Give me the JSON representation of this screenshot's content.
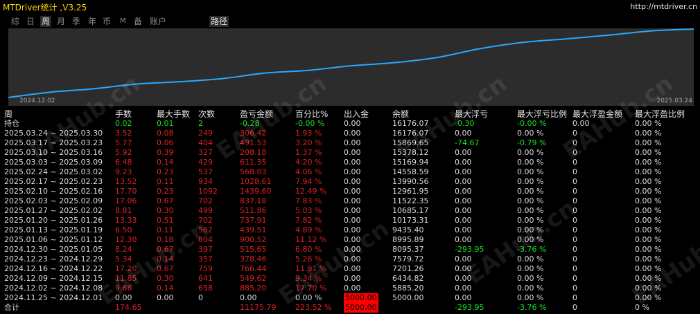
{
  "app": {
    "title": "MTDriver统计 ,V3.25",
    "url": "http://mtdriver.cn"
  },
  "tabs": [
    {
      "label": "综",
      "active": false
    },
    {
      "label": "日",
      "active": false
    },
    {
      "label": "周",
      "active": true
    },
    {
      "label": "月",
      "active": false
    },
    {
      "label": "季",
      "active": false
    },
    {
      "label": "年",
      "active": false
    },
    {
      "label": "币",
      "active": false
    },
    {
      "label": "M",
      "active": false
    },
    {
      "label": "备",
      "active": false
    },
    {
      "label": "账户",
      "active": false
    },
    {
      "label": "路径",
      "active": true
    }
  ],
  "colors": {
    "chart_bg": "#2c2c2c",
    "line": "#29a8ff",
    "red": "#e02020",
    "green": "#15e51e",
    "white": "#dcdcdc"
  },
  "chart_data": {
    "type": "line",
    "x_start_label": "2024.12.02",
    "x_end_label": "2025.03.24",
    "x": [
      "2024.12.02",
      "2024.12.09",
      "2024.12.16",
      "2024.12.23",
      "2024.12.30",
      "2025.01.06",
      "2025.01.13",
      "2025.01.20",
      "2025.01.27",
      "2025.02.03",
      "2025.02.10",
      "2025.02.17",
      "2025.02.24",
      "2025.03.03",
      "2025.03.10",
      "2025.03.17",
      "2025.03.24"
    ],
    "values": [
      5000.0,
      5885.2,
      6434.82,
      7201.26,
      7579.72,
      8095.37,
      8995.89,
      9435.4,
      10173.31,
      10685.17,
      11522.35,
      12961.95,
      13990.56,
      14558.59,
      15169.94,
      15869.65,
      16176.07
    ],
    "grid": false
  },
  "table": {
    "headers": [
      "周",
      "手数",
      "最大手数",
      "次数",
      "盈亏金额",
      "百分比%",
      "出入金",
      "余额",
      "最大浮亏",
      "最大浮亏比例",
      "最大浮盈金额",
      "最大浮盈比例"
    ],
    "holding": {
      "cells": [
        "持仓",
        "0.02",
        "0.01",
        "2",
        "-0.28",
        "-0.00 %",
        "0.00",
        "16176.07",
        "-0.30",
        "-0.00 %",
        "0.00",
        "0.00 %"
      ],
      "colors": [
        "w",
        "g",
        "g",
        "g",
        "g",
        "g",
        "w",
        "w",
        "g",
        "g",
        "w",
        "w"
      ]
    },
    "rows": [
      {
        "cells": [
          "2025.03.24 ~ 2025.03.30",
          "3.52",
          "0.08",
          "249",
          "306.42",
          "1.93 %",
          "0.00",
          "16176.07",
          "0.00",
          "0.00 %",
          "0",
          "0.00 %"
        ],
        "colors": [
          "w",
          "r",
          "r",
          "r",
          "r",
          "r",
          "w",
          "w",
          "w",
          "w",
          "w",
          "w"
        ]
      },
      {
        "cells": [
          "2025.03.17 ~ 2025.03.23",
          "5.77",
          "0.06",
          "404",
          "491.53",
          "3.20 %",
          "0.00",
          "15869.65",
          "-74.67",
          "-0.79 %",
          "0",
          "0.00 %"
        ],
        "colors": [
          "w",
          "r",
          "r",
          "r",
          "r",
          "r",
          "w",
          "w",
          "g",
          "g",
          "w",
          "w"
        ]
      },
      {
        "cells": [
          "2025.03.10 ~ 2025.03.16",
          "5.92",
          "0.39",
          "327",
          "208.18",
          "1.37 %",
          "0.00",
          "15378.12",
          "0.00",
          "0.00 %",
          "0",
          "0.00 %"
        ],
        "colors": [
          "w",
          "r",
          "r",
          "r",
          "r",
          "r",
          "w",
          "w",
          "w",
          "w",
          "w",
          "w"
        ]
      },
      {
        "cells": [
          "2025.03.03 ~ 2025.03.09",
          "6.48",
          "0.14",
          "429",
          "611.35",
          "4.20 %",
          "0.00",
          "15169.94",
          "0.00",
          "0.00 %",
          "0",
          "0.00 %"
        ],
        "colors": [
          "w",
          "r",
          "r",
          "r",
          "r",
          "r",
          "w",
          "w",
          "w",
          "w",
          "w",
          "w"
        ]
      },
      {
        "cells": [
          "2025.02.24 ~ 2025.03.02",
          "9.23",
          "0.23",
          "537",
          "568.03",
          "4.06 %",
          "0.00",
          "14558.59",
          "0.00",
          "0.00 %",
          "0",
          "0.00 %"
        ],
        "colors": [
          "w",
          "r",
          "r",
          "r",
          "r",
          "r",
          "w",
          "w",
          "w",
          "w",
          "w",
          "w"
        ]
      },
      {
        "cells": [
          "2025.02.17 ~ 2025.02.23",
          "13.52",
          "0.11",
          "934",
          "1028.61",
          "7.94 %",
          "0.00",
          "13990.56",
          "0.00",
          "0.00 %",
          "0",
          "0.00 %"
        ],
        "colors": [
          "w",
          "r",
          "r",
          "r",
          "r",
          "r",
          "w",
          "w",
          "w",
          "w",
          "w",
          "w"
        ]
      },
      {
        "cells": [
          "2025.02.10 ~ 2025.02.16",
          "17.70",
          "0.23",
          "1092",
          "1439.60",
          "12.49 %",
          "0.00",
          "12961.95",
          "0.00",
          "0.00 %",
          "0",
          "0.00 %"
        ],
        "colors": [
          "w",
          "r",
          "r",
          "r",
          "r",
          "r",
          "w",
          "w",
          "w",
          "w",
          "w",
          "w"
        ]
      },
      {
        "cells": [
          "2025.02.03 ~ 2025.02.09",
          "17.06",
          "0.67",
          "702",
          "837.18",
          "7.83 %",
          "0.00",
          "11522.35",
          "0.00",
          "0.00 %",
          "0",
          "0.00 %"
        ],
        "colors": [
          "w",
          "r",
          "r",
          "r",
          "r",
          "r",
          "w",
          "w",
          "w",
          "w",
          "w",
          "w"
        ]
      },
      {
        "cells": [
          "2025.01.27 ~ 2025.02.02",
          "8.81",
          "0.30",
          "499",
          "511.86",
          "5.03 %",
          "0.00",
          "10685.17",
          "0.00",
          "0.00 %",
          "0",
          "0.00 %"
        ],
        "colors": [
          "w",
          "r",
          "r",
          "r",
          "r",
          "r",
          "w",
          "w",
          "w",
          "w",
          "w",
          "w"
        ]
      },
      {
        "cells": [
          "2025.01.20 ~ 2025.01.26",
          "13.33",
          "0.51",
          "702",
          "737.91",
          "7.82 %",
          "0.00",
          "10173.31",
          "0.00",
          "0.00 %",
          "0",
          "0.00 %"
        ],
        "colors": [
          "w",
          "r",
          "r",
          "r",
          "r",
          "r",
          "w",
          "w",
          "w",
          "w",
          "w",
          "w"
        ]
      },
      {
        "cells": [
          "2025.01.13 ~ 2025.01.19",
          "6.50",
          "0.11",
          "562",
          "439.51",
          "4.89 %",
          "0.00",
          "9435.40",
          "0.00",
          "0.00 %",
          "0",
          "0.00 %"
        ],
        "colors": [
          "w",
          "r",
          "r",
          "r",
          "r",
          "r",
          "w",
          "w",
          "w",
          "w",
          "w",
          "w"
        ]
      },
      {
        "cells": [
          "2025.01.06 ~ 2025.01.12",
          "12.30",
          "0.18",
          "804",
          "900.52",
          "11.12 %",
          "0.00",
          "8995.89",
          "0.00",
          "0.00 %",
          "0",
          "0.00 %"
        ],
        "colors": [
          "w",
          "r",
          "r",
          "r",
          "r",
          "r",
          "w",
          "w",
          "w",
          "w",
          "w",
          "w"
        ]
      },
      {
        "cells": [
          "2024.12.30 ~ 2025.01.05",
          "8.24",
          "0.67",
          "397",
          "515.65",
          "6.80 %",
          "0.00",
          "8095.37",
          "-293.95",
          "-3.76 %",
          "0",
          "0.00 %"
        ],
        "colors": [
          "w",
          "r",
          "r",
          "r",
          "r",
          "r",
          "w",
          "w",
          "g",
          "g",
          "w",
          "w"
        ]
      },
      {
        "cells": [
          "2024.12.23 ~ 2024.12.29",
          "5.34",
          "0.14",
          "357",
          "378.46",
          "5.26 %",
          "0.00",
          "7579.72",
          "0.00",
          "0.00 %",
          "0",
          "0.00 %"
        ],
        "colors": [
          "w",
          "r",
          "r",
          "r",
          "r",
          "r",
          "w",
          "w",
          "w",
          "w",
          "w",
          "w"
        ]
      },
      {
        "cells": [
          "2024.12.16 ~ 2024.12.22",
          "17.20",
          "0.67",
          "759",
          "766.44",
          "11.91 %",
          "0.00",
          "7201.26",
          "0.00",
          "0.00 %",
          "0",
          "0.00 %"
        ],
        "colors": [
          "w",
          "r",
          "r",
          "r",
          "r",
          "r",
          "w",
          "w",
          "w",
          "w",
          "w",
          "w"
        ]
      },
      {
        "cells": [
          "2024.12.09 ~ 2024.12.15",
          "11.85",
          "0.30",
          "641",
          "549.62",
          "9.34 %",
          "0.00",
          "6434.82",
          "0.00",
          "0.00 %",
          "0",
          "0.00 %"
        ],
        "colors": [
          "w",
          "r",
          "r",
          "r",
          "r",
          "r",
          "w",
          "w",
          "w",
          "w",
          "w",
          "w"
        ]
      },
      {
        "cells": [
          "2024.12.02 ~ 2024.12.08",
          "9.86",
          "0.14",
          "658",
          "885.20",
          "17.70 %",
          "0.00",
          "5885.20",
          "0.00",
          "0.00 %",
          "0",
          "0.00 %"
        ],
        "colors": [
          "w",
          "r",
          "r",
          "r",
          "r",
          "r",
          "w",
          "w",
          "w",
          "w",
          "w",
          "w"
        ]
      },
      {
        "cells": [
          "2024.11.25 ~ 2024.12.01",
          "0.00",
          "0.00",
          "0",
          "0.00",
          "0.00 %",
          "5000.00",
          "5000.00",
          "0.00",
          "0.00 %",
          "0",
          "0.00 %"
        ],
        "colors": [
          "w",
          "w",
          "w",
          "w",
          "w",
          "w",
          "cash",
          "w",
          "w",
          "w",
          "w",
          "w"
        ]
      }
    ],
    "total": {
      "cells": [
        "合计",
        "174.65",
        "",
        "",
        "11175.79",
        "223.52 %",
        "5000.00",
        "",
        "-293.95",
        "-3.76 %",
        "0",
        "0 %"
      ],
      "colors": [
        "w",
        "r",
        "w",
        "w",
        "r",
        "r",
        "cash",
        "w",
        "g",
        "g",
        "w",
        "w"
      ]
    }
  },
  "watermark": "EAHub.cn"
}
